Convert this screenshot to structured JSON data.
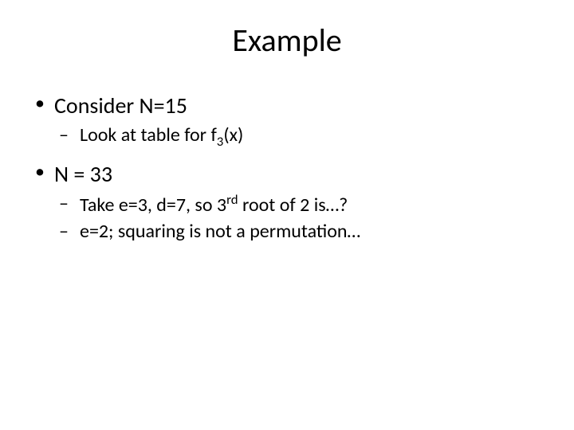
{
  "title": "Example",
  "bullets": [
    {
      "text": "Consider N=15",
      "children": [
        {
          "prefix": "Look at table for f",
          "sub": "3",
          "suffix": "(x)"
        }
      ]
    },
    {
      "text": "N = 33",
      "children": [
        {
          "prefix": "Take e=3, d=7, so 3",
          "sup": "rd",
          "suffix": " root of 2 is…?"
        },
        {
          "prefix": "e=2; squaring is not a permutation…",
          "sup": "",
          "suffix": ""
        }
      ]
    }
  ]
}
